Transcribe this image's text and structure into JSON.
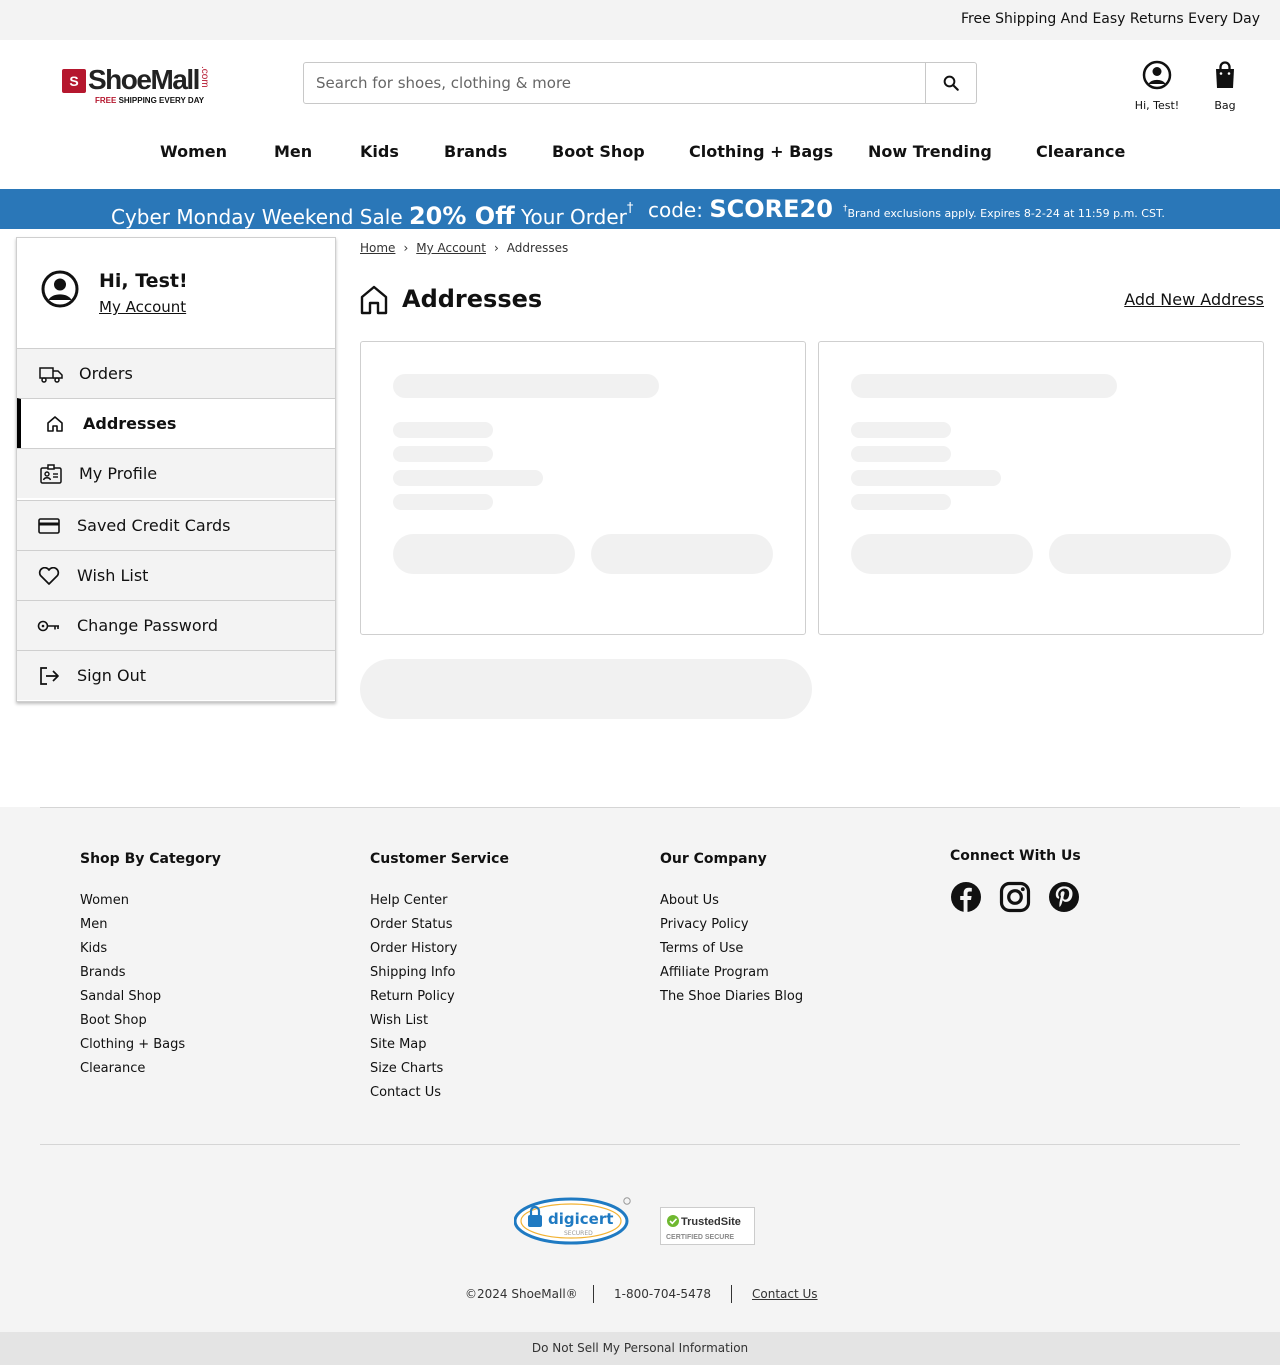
{
  "topbar": {
    "message": "Free Shipping And Easy Returns Every Day"
  },
  "logo": {
    "word": "ShoeMall",
    "com": ".com",
    "free": "FREE",
    "tagline": " SHIPPING EVERY DAY"
  },
  "search": {
    "placeholder": "Search for shoes, clothing & more"
  },
  "header": {
    "account_label": "Hi, Test!",
    "bag_label": "Bag"
  },
  "nav": [
    "Women",
    "Men",
    "Kids",
    "Brands",
    "Boot Shop",
    "Clothing + Bags",
    "Now Trending",
    "Clearance"
  ],
  "promo": {
    "lead": "Cyber Monday Weekend Sale ",
    "discount": "20% Off",
    "tail": " Your Order",
    "dagger": "†",
    "code_label": "code: ",
    "code": "SCORE20",
    "fine_dagger": "†",
    "fine": "Brand exclusions apply. Expires 8-2-24 at 11:59 p.m. CST."
  },
  "sidebar": {
    "greeting": "Hi, Test!",
    "account_link": "My Account",
    "items": [
      {
        "label": "Orders",
        "icon": "truck-icon"
      },
      {
        "label": "Addresses",
        "icon": "home-icon",
        "active": true
      },
      {
        "label": "My Profile",
        "icon": "id-card-icon"
      },
      {
        "label": "Saved Credit Cards",
        "icon": "credit-card-icon"
      },
      {
        "label": "Wish List",
        "icon": "heart-icon"
      },
      {
        "label": "Change Password",
        "icon": "key-icon"
      },
      {
        "label": "Sign Out",
        "icon": "sign-out-icon"
      }
    ]
  },
  "breadcrumb": {
    "home": "Home",
    "account": "My Account",
    "current": "Addresses"
  },
  "page": {
    "title": "Addresses",
    "add_new": "Add New Address"
  },
  "footer": {
    "shop": {
      "heading": "Shop By Category",
      "links": [
        "Women",
        "Men",
        "Kids",
        "Brands",
        "Sandal Shop",
        "Boot Shop",
        "Clothing + Bags",
        "Clearance"
      ]
    },
    "service": {
      "heading": "Customer Service",
      "links": [
        "Help Center",
        "Order Status",
        "Order History",
        "Shipping Info",
        "Return Policy",
        "Wish List",
        "Site Map",
        "Size Charts",
        "Contact Us"
      ]
    },
    "company": {
      "heading": "Our Company",
      "links": [
        "About Us",
        "Privacy Policy",
        "Terms of Use",
        "Affiliate Program",
        "The Shoe Diaries Blog"
      ]
    },
    "connect": {
      "heading": "Connect With Us",
      "icons": [
        "facebook-icon",
        "instagram-icon",
        "pinterest-icon"
      ]
    },
    "digicert": {
      "name": "digicert",
      "sub": "SECURED"
    },
    "trustedsite": {
      "name": "TrustedSite",
      "sub": "CERTIFIED SECURE"
    },
    "copyright": "©2024 ShoeMall®",
    "phone": "1-800-704-5478",
    "contact": "Contact Us",
    "dns": "Do Not Sell My Personal Information"
  },
  "colors": {
    "brand_red": "#b5172e",
    "promo_blue": "#2a77b8",
    "skeleton": "#f1f1f1"
  }
}
